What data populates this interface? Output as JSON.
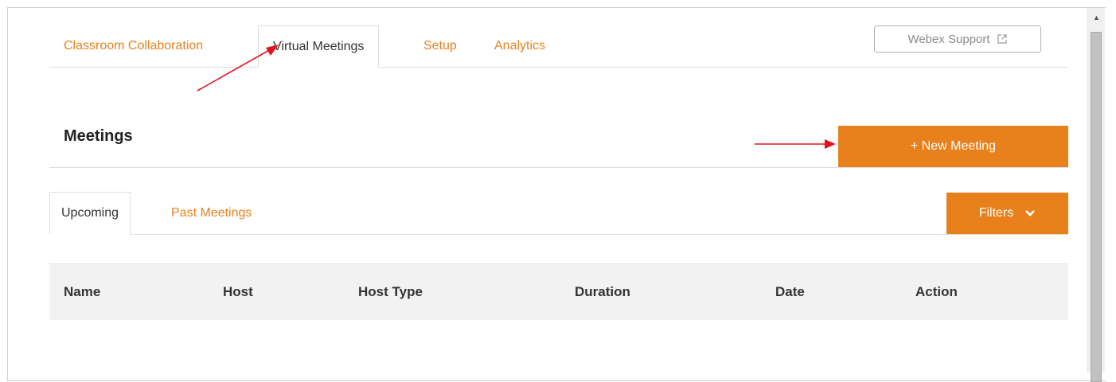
{
  "top_tabs": [
    {
      "label": "Classroom Collaboration",
      "active": false
    },
    {
      "label": "Virtual Meetings",
      "active": true
    },
    {
      "label": "Setup",
      "active": false
    },
    {
      "label": "Analytics",
      "active": false
    }
  ],
  "support": {
    "label": "Webex Support",
    "icon": "external-link-icon"
  },
  "meetings": {
    "title": "Meetings",
    "new_meeting_label": "+ New Meeting"
  },
  "sub_tabs": [
    {
      "label": "Upcoming",
      "active": true
    },
    {
      "label": "Past Meetings",
      "active": false
    }
  ],
  "filters": {
    "label": "Filters",
    "icon": "chevron-down-icon"
  },
  "table": {
    "columns": [
      "Name",
      "Host",
      "Host Type",
      "Duration",
      "Date",
      "Action"
    ]
  },
  "colors": {
    "accent": "#e8801c",
    "annotation": "#e0141e"
  }
}
